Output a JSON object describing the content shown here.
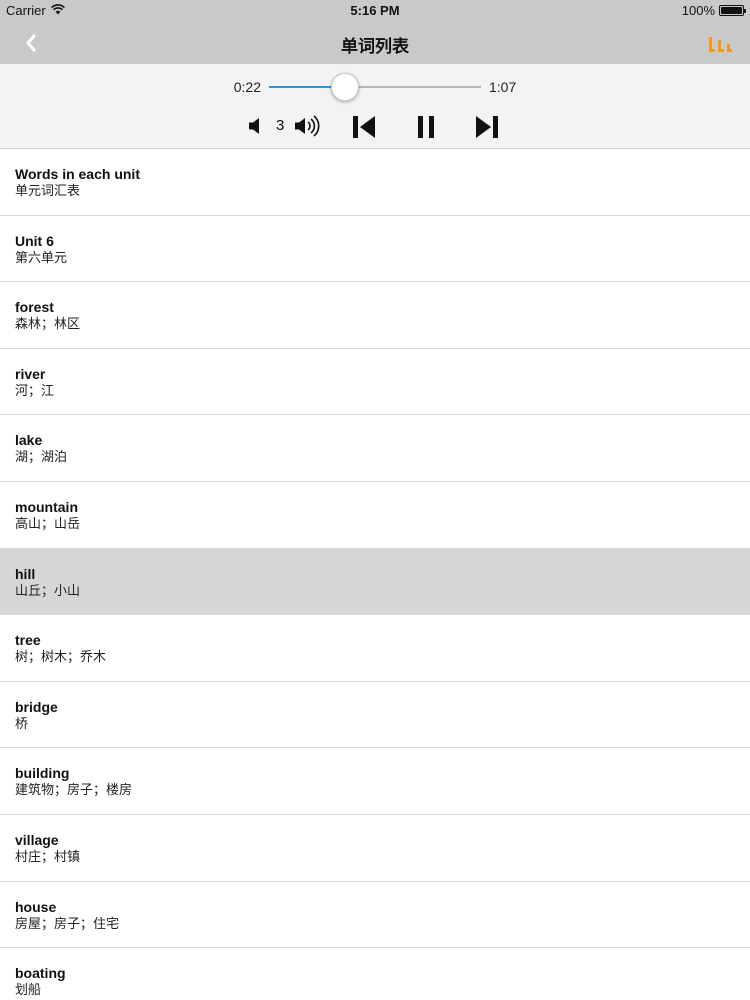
{
  "status": {
    "carrier": "Carrier",
    "time": "5:16 PM",
    "battery": "100%"
  },
  "nav": {
    "title": "单词列表",
    "accent_color": "#f29a1e"
  },
  "player": {
    "elapsed": "0:22",
    "total": "1:07",
    "progress": 0.36,
    "volume": "3",
    "accent_color": "#1e9be8",
    "icons": [
      "volume-down-icon",
      "volume-up-icon",
      "previous-icon",
      "pause-icon",
      "next-icon"
    ]
  },
  "words": [
    {
      "word": "Words in each unit",
      "meaning": "单元词汇表"
    },
    {
      "word": "Unit 6",
      "meaning": "第六单元"
    },
    {
      "word": "forest",
      "meaning": "森林；林区"
    },
    {
      "word": "river",
      "meaning": "河；江"
    },
    {
      "word": "lake",
      "meaning": "湖；湖泊"
    },
    {
      "word": "mountain",
      "meaning": "高山；山岳"
    },
    {
      "word": "hill",
      "meaning": "山丘；小山",
      "selected": true
    },
    {
      "word": "tree",
      "meaning": "树；树木；乔木"
    },
    {
      "word": "bridge",
      "meaning": "桥"
    },
    {
      "word": "building",
      "meaning": "建筑物；房子；楼房"
    },
    {
      "word": "village",
      "meaning": "村庄；村镇"
    },
    {
      "word": "house",
      "meaning": "房屋；房子；住宅"
    },
    {
      "word": "boating",
      "meaning": "划船"
    }
  ]
}
